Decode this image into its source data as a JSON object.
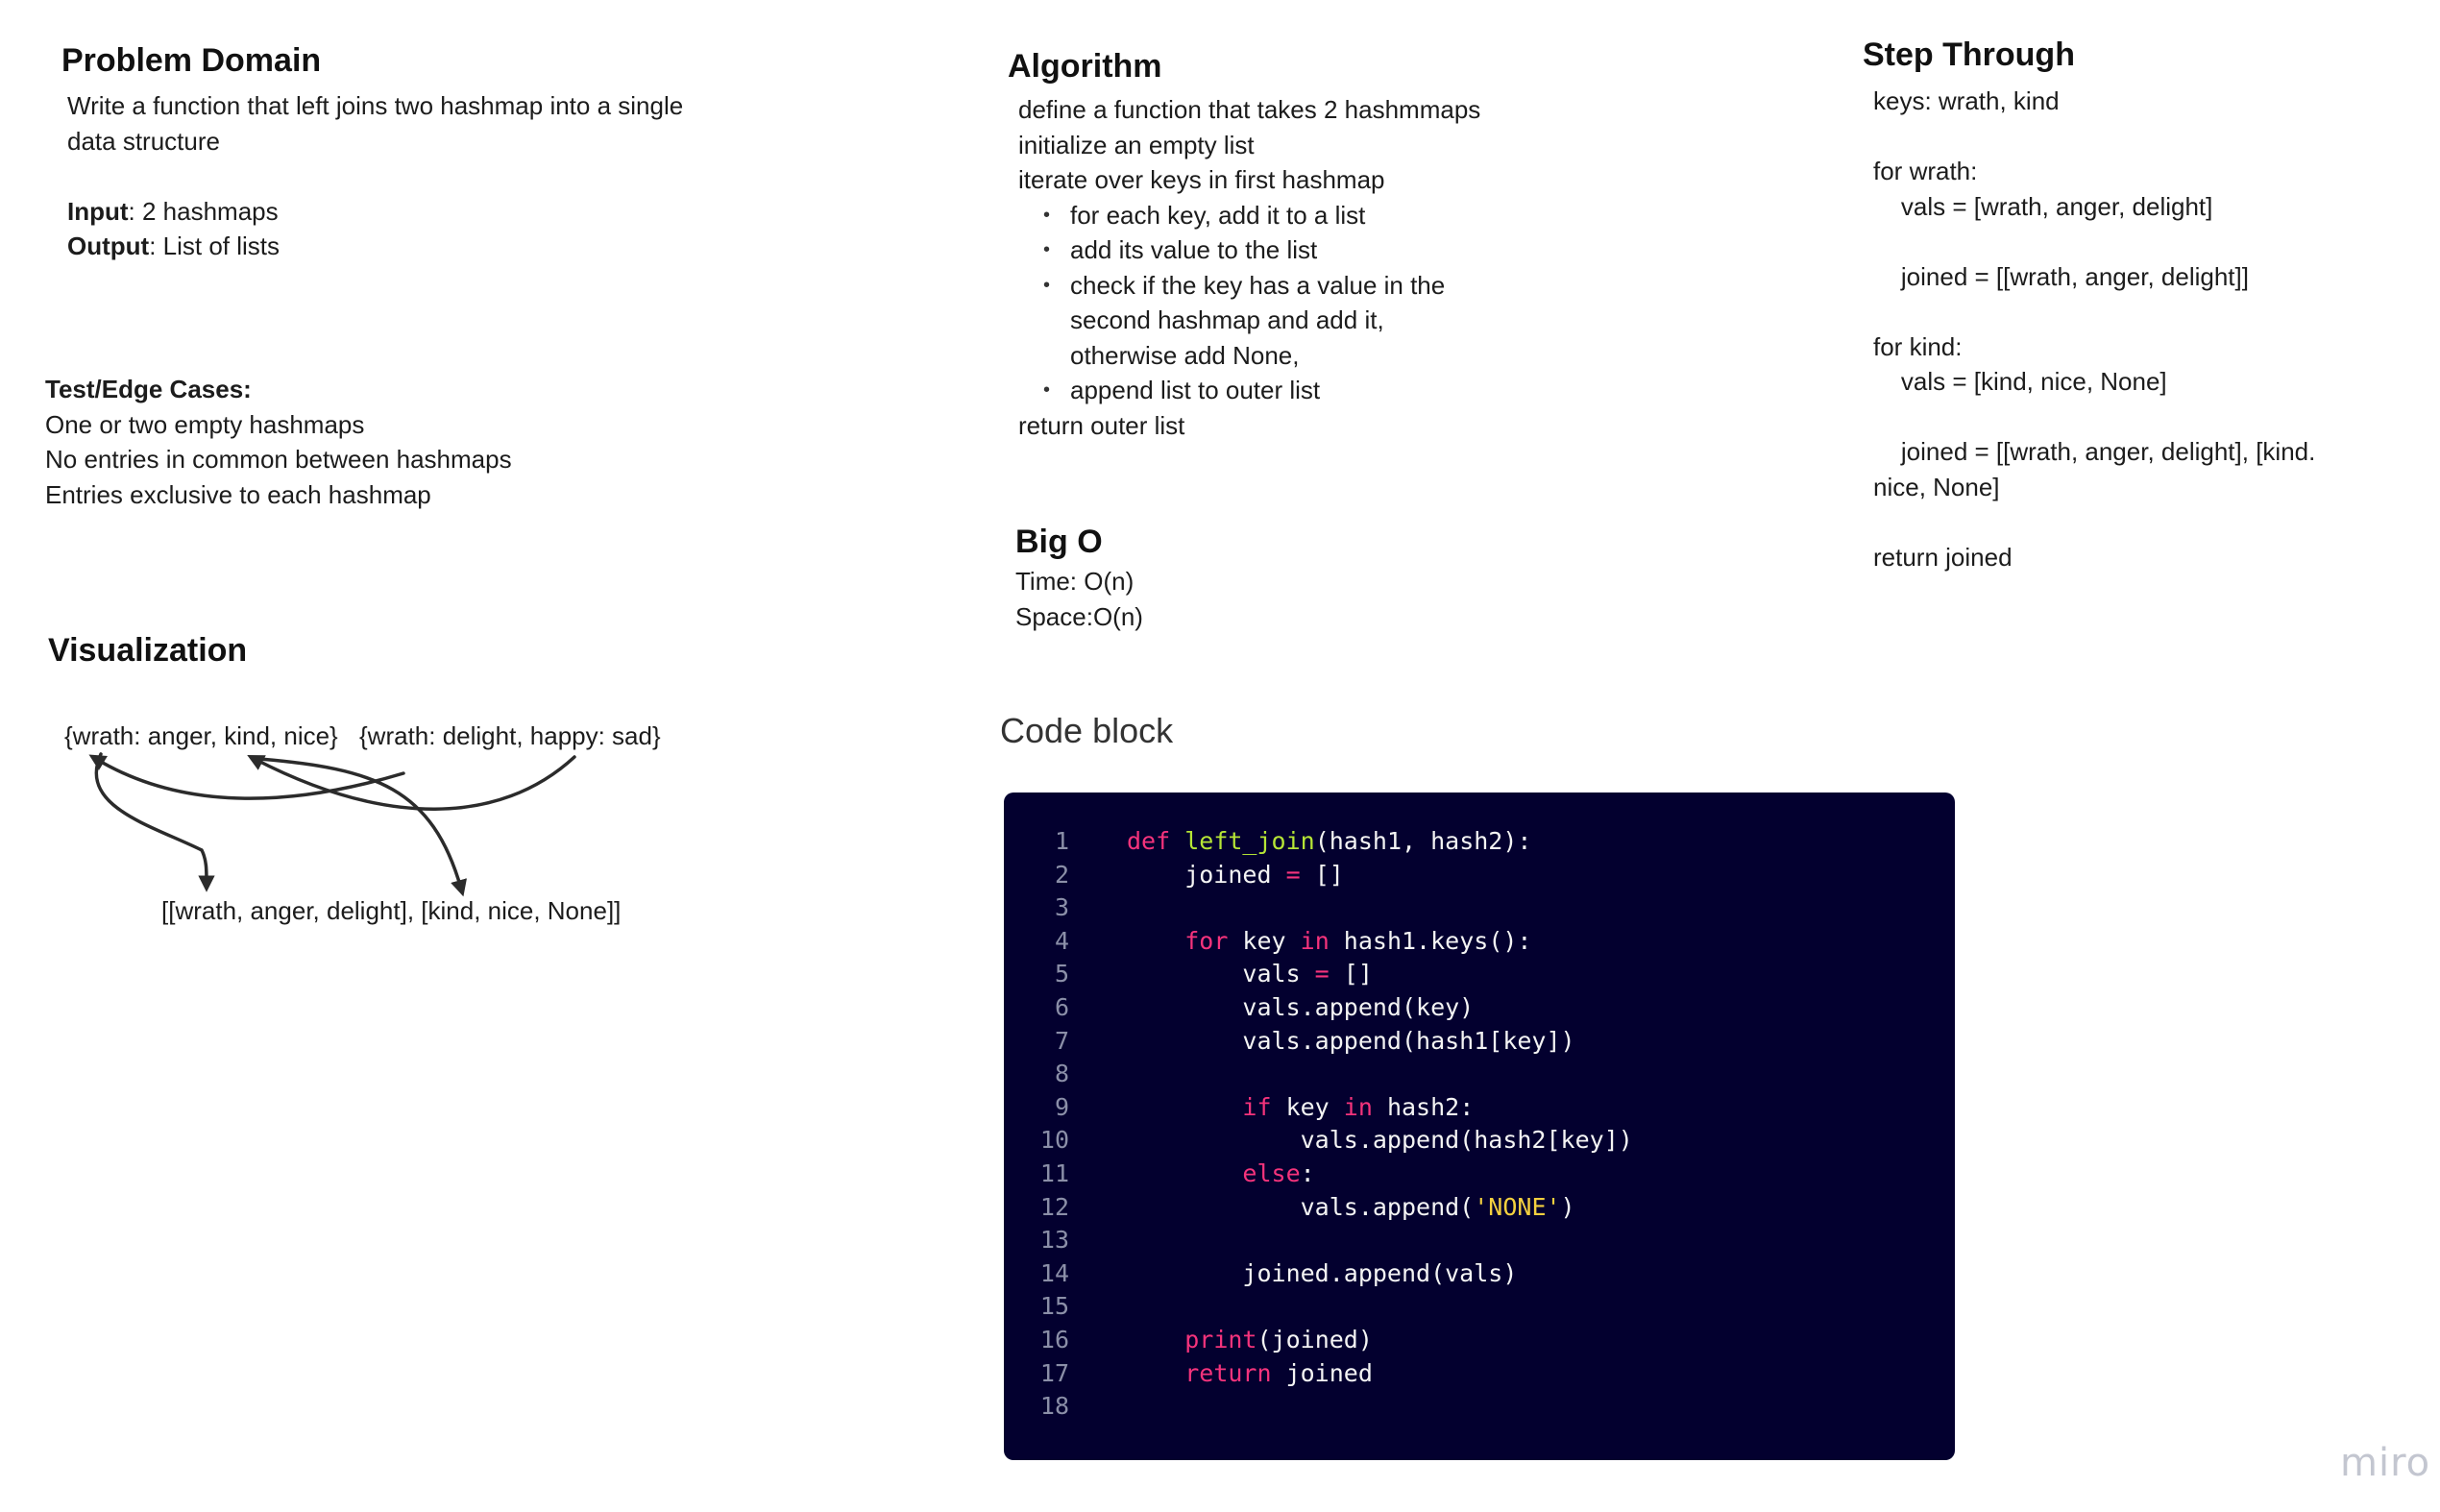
{
  "problem_domain": {
    "title": "Problem Domain",
    "desc_line1": "Write a function that left joins two hashmap into a single",
    "desc_line2": "data structure",
    "input_label": "Input",
    "input_value": ": 2 hashmaps",
    "output_label": "Output",
    "output_value": ": List of lists"
  },
  "test_cases": {
    "title": "Test/Edge Cases:",
    "items": [
      "One or two empty hashmaps",
      "No entries in common between hashmaps",
      "Entries exclusive to each hashmap"
    ]
  },
  "visualization": {
    "title": "Visualization",
    "hash1": "{wrath: anger, kind, nice}",
    "hash2": "{wrath: delight, happy: sad}",
    "result": "[[wrath, anger, delight], [kind, nice, None]]"
  },
  "algorithm": {
    "title": "Algorithm",
    "lines_top": [
      "define a function that takes 2 hashmmaps",
      "initialize an empty list",
      "iterate over keys in first hashmap"
    ],
    "bullet1": "for each key, add it to a list",
    "bullet2": "add its value to the list",
    "bullet3_line1": "check if the key has a value in the",
    "bullet3_line2": "second hashmap and add it,",
    "bullet3_line3": "otherwise add None,",
    "bullet4": "append list to outer list",
    "last_line": "return outer list"
  },
  "big_o": {
    "title": "Big O",
    "time": "Time: O(n)",
    "space": "Space:O(n)"
  },
  "step_through": {
    "title": "Step Through",
    "lines": [
      "keys: wrath, kind",
      "",
      "for wrath:",
      "    vals = [wrath, anger, delight]",
      "",
      "    joined = [[wrath, anger, delight]]",
      "",
      "for kind:",
      "    vals = [kind, nice, None]",
      "",
      "    joined = [[wrath, anger, delight], [kind.",
      "nice, None]",
      "",
      "return joined"
    ]
  },
  "code_block": {
    "title": "Code block",
    "line_numbers": [
      "1",
      "2",
      "3",
      "4",
      "5",
      "6",
      "7",
      "8",
      "9",
      "10",
      "11",
      "12",
      "13",
      "14",
      "15",
      "16",
      "17",
      "18"
    ],
    "colors": {
      "background": "#03002f",
      "keyword": "#f5337c",
      "function": "#b6e536",
      "string": "#f4d03f",
      "text": "#f4f4f4",
      "line_number": "#8b8fa8"
    },
    "lines": [
      [
        {
          "t": "def",
          "c": "kw"
        },
        {
          "t": " "
        },
        {
          "t": "left_join",
          "c": "fn"
        },
        {
          "t": "(hash1, hash2):"
        }
      ],
      [
        {
          "t": "    joined "
        },
        {
          "t": "=",
          "c": "kw"
        },
        {
          "t": " []"
        }
      ],
      [],
      [
        {
          "t": "    "
        },
        {
          "t": "for",
          "c": "kw"
        },
        {
          "t": " key "
        },
        {
          "t": "in",
          "c": "kw"
        },
        {
          "t": " hash1.keys():"
        }
      ],
      [
        {
          "t": "        vals "
        },
        {
          "t": "=",
          "c": "kw"
        },
        {
          "t": " []"
        }
      ],
      [
        {
          "t": "        vals.append(key)"
        }
      ],
      [
        {
          "t": "        vals.append(hash1[key])"
        }
      ],
      [],
      [
        {
          "t": "        "
        },
        {
          "t": "if",
          "c": "kw"
        },
        {
          "t": " key "
        },
        {
          "t": "in",
          "c": "kw"
        },
        {
          "t": " hash2:"
        }
      ],
      [
        {
          "t": "            vals.append(hash2[key])"
        }
      ],
      [
        {
          "t": "        "
        },
        {
          "t": "else",
          "c": "kw"
        },
        {
          "t": ":"
        }
      ],
      [
        {
          "t": "            vals.append("
        },
        {
          "t": "'NONE'",
          "c": "str"
        },
        {
          "t": ")"
        }
      ],
      [],
      [
        {
          "t": "        joined.append(vals)"
        }
      ],
      [],
      [
        {
          "t": "    "
        },
        {
          "t": "print",
          "c": "kw"
        },
        {
          "t": "(joined)"
        }
      ],
      [
        {
          "t": "    "
        },
        {
          "t": "return",
          "c": "kw"
        },
        {
          "t": " joined"
        }
      ],
      []
    ]
  },
  "branding": {
    "logo": "miro"
  }
}
